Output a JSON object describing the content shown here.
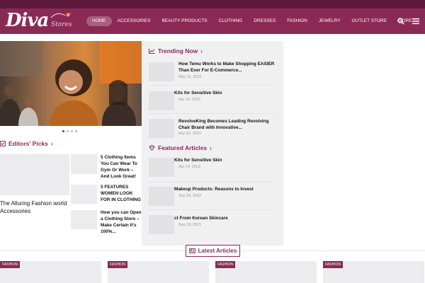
{
  "brand": {
    "logo_text": "Diva",
    "logo_sub": "Stores",
    "accent": "#8a2a54",
    "top_strip": "#5e1a3a"
  },
  "nav": {
    "items": [
      "HOME",
      "ACCESSORIES",
      "BEAUTY PRODUCTS",
      "CLOTHING",
      "DRESSES",
      "FASHION",
      "JEWELRY",
      "OUTLET STORE",
      "MORE"
    ],
    "active": "HOME",
    "icons": [
      "search-icon",
      "menu-icon"
    ]
  },
  "slider": {
    "slides": 4,
    "active_index": 0
  },
  "editors_picks": {
    "title": "Editors' Picks",
    "featured_title": "The Alluring Fashion world Accessories",
    "items": [
      "5 Clothing Items You Can Wear To Gym Or Work – And Look Great!",
      "5 FEATURES WOMEN LOOK FOR IN CLOTHING",
      "How you can Open a Clothing Store – Make Certain It's 100%..."
    ]
  },
  "trending": {
    "title": "Trending Now",
    "items": [
      {
        "title": "How Temu Works to Make Shopping EASIER Than Ever For E-Commerce...",
        "date": "May 11, 2023"
      },
      {
        "title": "Kits for Sensitive Skin",
        "date": "Apr 14, 2023"
      },
      {
        "title": "RevolveKing Becomes Leading Revolving Chair Brand with Innovative...",
        "date": "Mar 22, 2023"
      }
    ]
  },
  "featured": {
    "title": "Featured Articles",
    "items": [
      {
        "title": "Kits for Sensitive Skin",
        "date": "Apr 14, 2023"
      },
      {
        "title": "Makeup Products: Reasons to Invest",
        "date": "Sep 29, 2022"
      },
      {
        "title": "ct From Korean Skincare",
        "date": "Sep 23, 2021"
      }
    ]
  },
  "latest": {
    "title": "Latest Articles",
    "cards": [
      {
        "badge": "FASHION"
      },
      {
        "badge": "FASHION"
      },
      {
        "badge": "FASHION"
      },
      {
        "badge": "FASHION"
      }
    ]
  }
}
